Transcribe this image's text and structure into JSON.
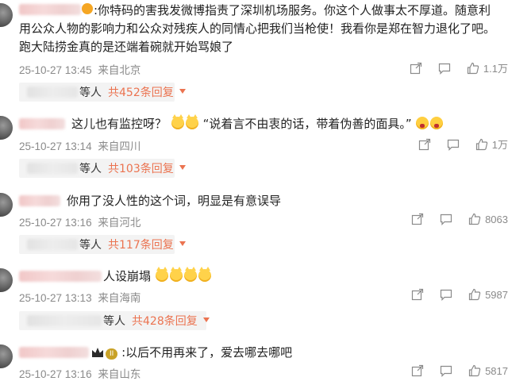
{
  "colors": {
    "accent": "#eb7350",
    "meta": "#8a8a8a",
    "reply_bg": "#f3f3f3"
  },
  "comments": [
    {
      "text": ":你特码的害我发微博指责了深圳机场服务。你这个人做事太不厚道。随意利用公众人物的影响力和公众对残疾人的同情心把我们当枪使！我看你是郑在智力退化了吧。跑大陆捞金真的是还端着碗就开始骂娘了",
      "time": "25-10-27 13:45",
      "location": "来自北京",
      "likes": "1.1万",
      "reply_who": "等人",
      "reply_count": "共452条回复"
    },
    {
      "text_a": "这儿也有监控呀？",
      "text_b": "“说着言不由衷的话，带着伪善的面具。”",
      "time": "25-10-27 13:14",
      "location": "来自四川",
      "likes": "1万",
      "reply_who": "等人",
      "reply_count": "共103条回复"
    },
    {
      "text": "你用了没人性的这个词，明显是有意误导",
      "time": "25-10-27 13:16",
      "location": "来自河北",
      "likes": "8063",
      "reply_who": "等人",
      "reply_count": "共117条回复"
    },
    {
      "text": "人设崩塌",
      "time": "25-10-27 13:13",
      "location": "来自海南",
      "likes": "5987",
      "reply_who": "等人",
      "reply_count": "共428条回复"
    },
    {
      "badge": "II",
      "text": ":以后不用再来了，爱去哪去哪吧",
      "time": "25-10-27 13:16",
      "location": "来自山东",
      "likes": "5817"
    }
  ],
  "icons": {
    "share": "share-icon",
    "comment": "comment-icon",
    "like": "thumbs-up-icon",
    "emoji_cat": "cat-face-emoji",
    "emoji_shock": "screaming-face-emoji",
    "crown": "crown-icon",
    "status": "sun-badge-icon"
  }
}
